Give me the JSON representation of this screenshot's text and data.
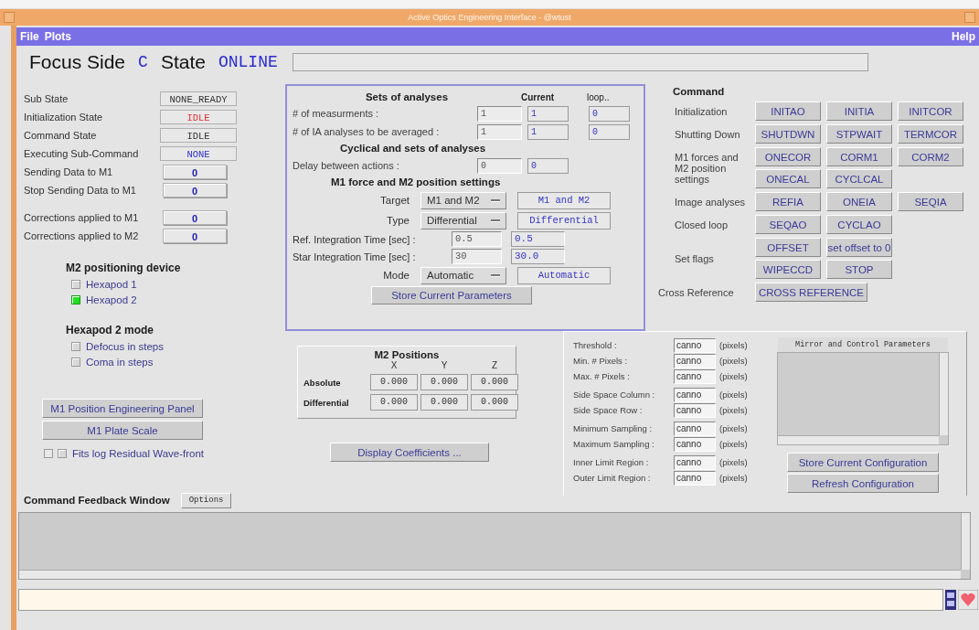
{
  "window": {
    "title": "Active Optics Engineering Interface - @wtust"
  },
  "menu": {
    "left": [
      "File",
      "Plots"
    ],
    "right": [
      "Help"
    ]
  },
  "header": {
    "focus_side_label": "Focus Side",
    "focus_side": "C",
    "state_label": "State",
    "state": "ONLINE"
  },
  "status_groups": [
    [
      {
        "label": "Sub State",
        "value": "NONE_READY",
        "kind": "text",
        "color": "#303030"
      },
      {
        "label": "Initialization State",
        "value": "IDLE",
        "kind": "text",
        "color": "#e03030"
      },
      {
        "label": "Command State",
        "value": "IDLE",
        "kind": "text",
        "color": "#303030"
      },
      {
        "label": "Executing Sub-Command",
        "value": "NONE",
        "kind": "text",
        "color": "#3030d0"
      },
      {
        "label": "Sending Data to M1",
        "value": "0",
        "kind": "counter",
        "color": "#2020b0"
      },
      {
        "label": "Stop Sending Data to M1",
        "value": "0",
        "kind": "counter",
        "color": "#2020b0"
      }
    ],
    [
      {
        "label": "Corrections applied to M1",
        "value": "0",
        "kind": "counter",
        "color": "#2020b0"
      },
      {
        "label": "Corrections applied to M2",
        "value": "0",
        "kind": "counter",
        "color": "#2020b0"
      }
    ]
  ],
  "m2_device": {
    "title": "M2 positioning device",
    "options": [
      {
        "label": "Hexapod 1",
        "selected": false
      },
      {
        "label": "Hexapod 2",
        "selected": true
      }
    ]
  },
  "hexapod_mode": {
    "title": "Hexapod 2 mode",
    "options": [
      {
        "label": "Defocus in steps",
        "checked": false
      },
      {
        "label": "Coma in steps",
        "checked": false
      }
    ]
  },
  "left_buttons": [
    "M1 Position Engineering Panel",
    "M1 Plate Scale"
  ],
  "fits_log": {
    "label": "Fits log Residual Wave-front",
    "checked": false
  },
  "analyses": {
    "title": "Sets of analyses",
    "col_current": "Current",
    "col_loop": "loop..",
    "rows": [
      {
        "label": "# of measurments :",
        "input": "1",
        "current": "1",
        "loop": "0"
      },
      {
        "label": "# of IA analyses to be averaged :",
        "input": "1",
        "current": "1",
        "loop": "0"
      }
    ],
    "cyclical_title": "Cyclical and sets of analyses",
    "delay": {
      "label": "Delay between actions :",
      "input": "0",
      "current": "0"
    },
    "settings_title": "M1 force and M2 position settings",
    "settings": [
      {
        "kind": "select",
        "label": "Target",
        "value": "M1 and M2",
        "current": "M1 and M2"
      },
      {
        "kind": "select",
        "label": "Type",
        "value": "Differential",
        "current": "Differential"
      },
      {
        "kind": "time",
        "label": "Ref.  Integration Time [sec] :",
        "value": "0.5",
        "current": "0.5"
      },
      {
        "kind": "time",
        "label": "Star Integration Time [sec] :",
        "value": "30",
        "current": "30.0"
      },
      {
        "kind": "select",
        "label": "Mode",
        "value": "Automatic",
        "current": "Automatic"
      }
    ],
    "store_button": "Store Current Parameters"
  },
  "command": {
    "title": "Command",
    "groups": [
      {
        "label": "Initialization",
        "rows": [
          [
            "INITAO",
            "INITIA",
            "INITCOR"
          ]
        ]
      },
      {
        "label": "Shutting Down",
        "rows": [
          [
            "SHUTDWN",
            "STPWAIT",
            "TERMCOR"
          ]
        ]
      },
      {
        "label": "M1 forces and M2 position settings",
        "rows": [
          [
            "ONECOR",
            "CORM1",
            "CORM2"
          ],
          [
            "ONECAL",
            "CYCLCAL"
          ]
        ]
      },
      {
        "label": "Image analyses",
        "rows": [
          [
            "REFIA",
            "ONEIA",
            "SEQIA"
          ]
        ]
      },
      {
        "label": "Closed loop",
        "rows": [
          [
            "SEQAO",
            "CYCLAO"
          ]
        ]
      },
      {
        "label": "Set flags",
        "rows": [
          [
            "OFFSET",
            "set offset to 0"
          ],
          [
            "WIPECCD",
            "STOP"
          ]
        ]
      },
      {
        "label": "Cross Reference",
        "rows": [
          [
            "CROSS REFERENCE"
          ]
        ]
      }
    ]
  },
  "m2_positions": {
    "title": "M2 Positions",
    "columns": [
      "X",
      "Y",
      "Z"
    ],
    "rows": [
      {
        "label": "Absolute",
        "values": [
          "0.000",
          "0.000",
          "0.000"
        ]
      },
      {
        "label": "Differential",
        "values": [
          "0.000",
          "0.000",
          "0.000"
        ]
      }
    ]
  },
  "display_button": "Display Coefficients ...",
  "parameter_groups": [
    [
      {
        "label": "Threshold :",
        "value": "canno",
        "unit": "(pixels)"
      },
      {
        "label": "Min. # Pixels :",
        "value": "canno",
        "unit": "(pixels)"
      },
      {
        "label": "Max. # Pixels :",
        "value": "canno",
        "unit": "(pixels)"
      }
    ],
    [
      {
        "label": "Side Space Column :",
        "value": "canno",
        "unit": "(pixels)"
      },
      {
        "label": "Side Space Row :",
        "value": "canno",
        "unit": "(pixels)"
      }
    ],
    [
      {
        "label": "Minimum Sampling :",
        "value": "canno",
        "unit": "(pixels)"
      },
      {
        "label": "Maximum Sampling :",
        "value": "canno",
        "unit": "(pixels)"
      }
    ],
    [
      {
        "label": "Inner Limit Region :",
        "value": "canno",
        "unit": "(pixels)"
      },
      {
        "label": "Outer Limit Region :",
        "value": "canno",
        "unit": "(pixels)"
      }
    ]
  ],
  "mirror_params": {
    "title": "Mirror and Control Parameters",
    "buttons": [
      "Store Current Configuration",
      "Refresh Configuration"
    ]
  },
  "feedback": {
    "title": "Command Feedback Window",
    "options_button": "Options"
  }
}
